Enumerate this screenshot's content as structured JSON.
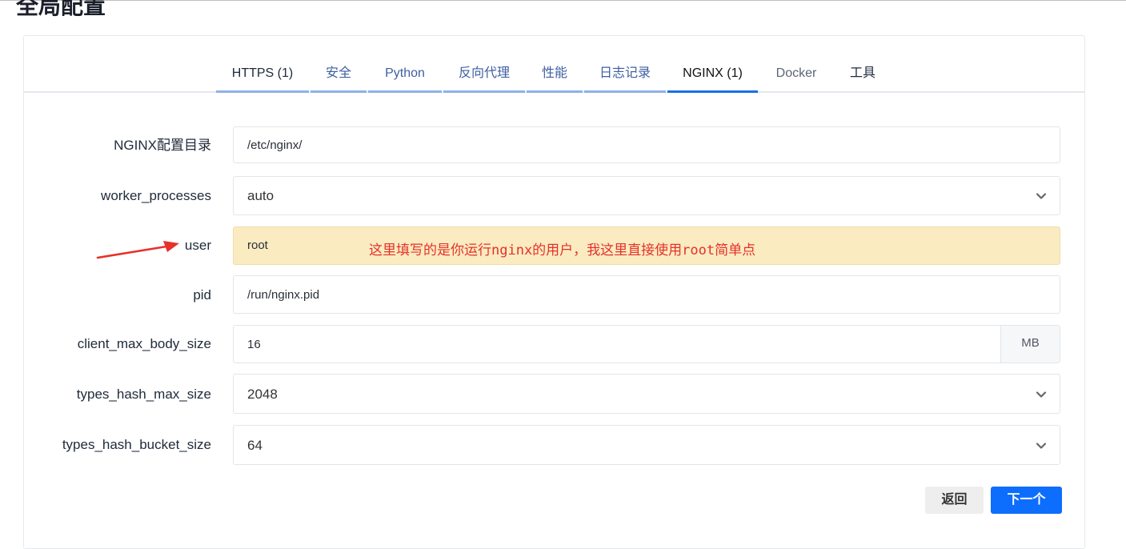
{
  "page": {
    "title": "全局配置"
  },
  "tabs": [
    {
      "label": "HTTPS (1)"
    },
    {
      "label": "安全"
    },
    {
      "label": "Python"
    },
    {
      "label": "反向代理"
    },
    {
      "label": "性能"
    },
    {
      "label": "日志记录"
    },
    {
      "label": "NGINX (1)"
    },
    {
      "label": "Docker"
    },
    {
      "label": "工具"
    }
  ],
  "form": {
    "config_dir": {
      "label": "NGINX配置目录",
      "value": "/etc/nginx/"
    },
    "worker_processes": {
      "label": "worker_processes",
      "value": "auto"
    },
    "user": {
      "label": "user",
      "value": "root"
    },
    "pid": {
      "label": "pid",
      "value": "/run/nginx.pid"
    },
    "client_max_body_size": {
      "label": "client_max_body_size",
      "value": "16",
      "unit": "MB"
    },
    "types_hash_max_size": {
      "label": "types_hash_max_size",
      "value": "2048"
    },
    "types_hash_bucket_size": {
      "label": "types_hash_bucket_size",
      "value": "64"
    }
  },
  "annotation": {
    "text": "这里填写的是你运行nginx的用户，我这里直接使用root简单点",
    "color": "#e6312a"
  },
  "buttons": {
    "back": "返回",
    "next": "下一个"
  },
  "colors": {
    "accent": "#0d6efd",
    "highlight": "#faebc1",
    "tab_underline": "#8fb1e6"
  }
}
